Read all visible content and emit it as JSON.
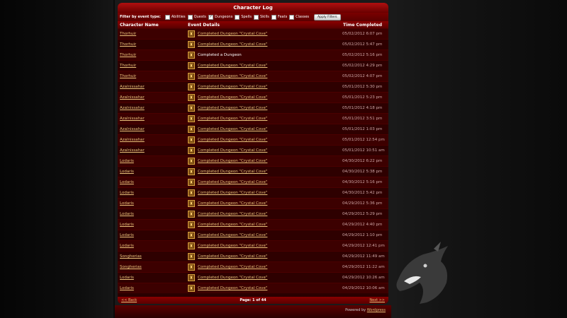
{
  "panel": {
    "title": "Character Log"
  },
  "filters": {
    "label": "Filter by event type:",
    "options": [
      {
        "label": "Abilities",
        "checked": false
      },
      {
        "label": "Quests",
        "checked": false
      },
      {
        "label": "Dungeons",
        "checked": true
      },
      {
        "label": "Spells",
        "checked": false
      },
      {
        "label": "Skills",
        "checked": false
      },
      {
        "label": "Feats",
        "checked": false
      },
      {
        "label": "Classes",
        "checked": false
      }
    ],
    "apply_label": "Apply Filters"
  },
  "table": {
    "headers": {
      "name": "Character Name",
      "event": "Event Details",
      "time": "Time Completed"
    },
    "rows": [
      {
        "name": "Thorhuir",
        "event": "Completed Dungeon \"Crystal Cove\"",
        "link": true,
        "time": "05/02/2012 6:07 pm"
      },
      {
        "name": "Thorhuir",
        "event": "Completed Dungeon \"Crystal Cove\"",
        "link": true,
        "time": "05/02/2012 5:47 pm"
      },
      {
        "name": "Thorhuir",
        "event": "Completed a Dungeon",
        "link": false,
        "time": "05/02/2012 5:16 pm"
      },
      {
        "name": "Thorhuir",
        "event": "Completed Dungeon \"Crystal Cove\"",
        "link": true,
        "time": "05/02/2012 4:29 pm"
      },
      {
        "name": "Thorhuir",
        "event": "Completed Dungeon \"Crystal Cove\"",
        "link": true,
        "time": "05/02/2012 4:07 pm"
      },
      {
        "name": "Azalnissahar",
        "event": "Completed Dungeon \"Crystal Cove\"",
        "link": true,
        "time": "05/01/2012 5:30 pm"
      },
      {
        "name": "Azalnissahar",
        "event": "Completed Dungeon \"Crystal Cove\"",
        "link": true,
        "time": "05/01/2012 5:23 pm"
      },
      {
        "name": "Azalnissahar",
        "event": "Completed Dungeon \"Crystal Cove\"",
        "link": true,
        "time": "05/01/2012 4:18 pm"
      },
      {
        "name": "Azalnissahar",
        "event": "Completed Dungeon \"Crystal Cove\"",
        "link": true,
        "time": "05/01/2012 3:51 pm"
      },
      {
        "name": "Azalnissahar",
        "event": "Completed Dungeon \"Crystal Cove\"",
        "link": true,
        "time": "05/01/2012 1:03 pm"
      },
      {
        "name": "Azalnissahar",
        "event": "Completed Dungeon \"Crystal Cove\"",
        "link": true,
        "time": "05/01/2012 12:54 pm"
      },
      {
        "name": "Azalnissahar",
        "event": "Completed Dungeon \"Crystal Cove\"",
        "link": true,
        "time": "05/01/2012 10:51 am"
      },
      {
        "name": "Lodaris",
        "event": "Completed Dungeon \"Crystal Cove\"",
        "link": true,
        "time": "04/30/2012 6:22 pm"
      },
      {
        "name": "Lodaris",
        "event": "Completed Dungeon \"Crystal Cove\"",
        "link": true,
        "time": "04/30/2012 5:38 pm"
      },
      {
        "name": "Lodaris",
        "event": "Completed Dungeon \"Crystal Cove\"",
        "link": true,
        "time": "04/30/2012 5:16 pm"
      },
      {
        "name": "Lodaris",
        "event": "Completed Dungeon \"Crystal Cove\"",
        "link": true,
        "time": "04/30/2012 5:42 pm"
      },
      {
        "name": "Lodaris",
        "event": "Completed Dungeon \"Crystal Cove\"",
        "link": true,
        "time": "04/29/2012 5:36 pm"
      },
      {
        "name": "Lodaris",
        "event": "Completed Dungeon \"Crystal Cove\"",
        "link": true,
        "time": "04/29/2012 5:29 pm"
      },
      {
        "name": "Lodaris",
        "event": "Completed Dungeon \"Crystal Cove\"",
        "link": true,
        "time": "04/29/2012 4:40 pm"
      },
      {
        "name": "Lodaris",
        "event": "Completed Dungeon \"Crystal Cove\"",
        "link": true,
        "time": "04/29/2012 1:10 pm"
      },
      {
        "name": "Lodaris",
        "event": "Completed Dungeon \"Crystal Cove\"",
        "link": true,
        "time": "04/29/2012 12:41 pm"
      },
      {
        "name": "Songherias",
        "event": "Completed Dungeon \"Crystal Cove\"",
        "link": true,
        "time": "04/29/2012 11:49 am"
      },
      {
        "name": "Songherias",
        "event": "Completed Dungeon \"Crystal Cove\"",
        "link": true,
        "time": "04/29/2012 11:22 am"
      },
      {
        "name": "Lodaris",
        "event": "Completed Dungeon \"Crystal Cove\"",
        "link": true,
        "time": "04/29/2012 10:26 am"
      },
      {
        "name": "Lodaris",
        "event": "Completed Dungeon \"Crystal Cove\"",
        "link": true,
        "time": "04/29/2012 10:06 am"
      }
    ]
  },
  "pagination": {
    "back_label": "<< Back",
    "page_label": "Page: 1 of 44",
    "next_label": "Next >>"
  },
  "footer": {
    "powered_text": "Powered by ",
    "powered_link": "Wordpress"
  },
  "colors": {
    "accent": "#b01010",
    "link": "#e8c27a",
    "row_odd": "#3c0000",
    "row_even": "#2e0000"
  },
  "icons": {
    "event": "trophy-icon"
  }
}
